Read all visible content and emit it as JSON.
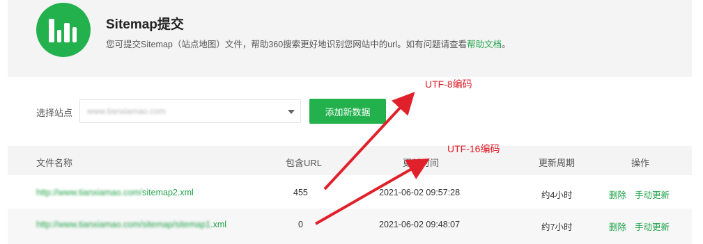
{
  "header": {
    "title": "Sitemap提交",
    "description": "您可提交Sitemap（站点地图）文件，帮助360搜索更好地识别您网站中的url。如有问题请查看",
    "help_link": "帮助文档",
    "description_end": "。",
    "logo_icon": "bar-chart-icon"
  },
  "site_selector": {
    "label": "选择站点",
    "value": "www.tianxiamao.com"
  },
  "add_button": "添加新数据",
  "table": {
    "headers": [
      "文件名称",
      "包含URL",
      "更新时间",
      "更新周期",
      "操作"
    ],
    "rows": [
      {
        "file_prefix": "http://www.tianxiamao.com/",
        "file_suffix": "sitemap2.xml",
        "url_count": "455",
        "updated": "2021-06-02 09:57:28",
        "cycle": "约4小时",
        "delete": "删除",
        "manual": "手动更新"
      },
      {
        "file_prefix": "http://www.tianxiamao.com/sitemap/sitemap1",
        "file_suffix": ".xml",
        "url_count": "0",
        "updated": "2021-06-02 09:48:07",
        "cycle": "约7小时",
        "delete": "删除",
        "manual": "手动更新"
      }
    ]
  },
  "annotations": {
    "utf8": "UTF-8编码",
    "utf16": "UTF-16编码",
    "color": "#e0202a"
  },
  "colors": {
    "accent": "#22b14c",
    "link": "#22a34a"
  }
}
